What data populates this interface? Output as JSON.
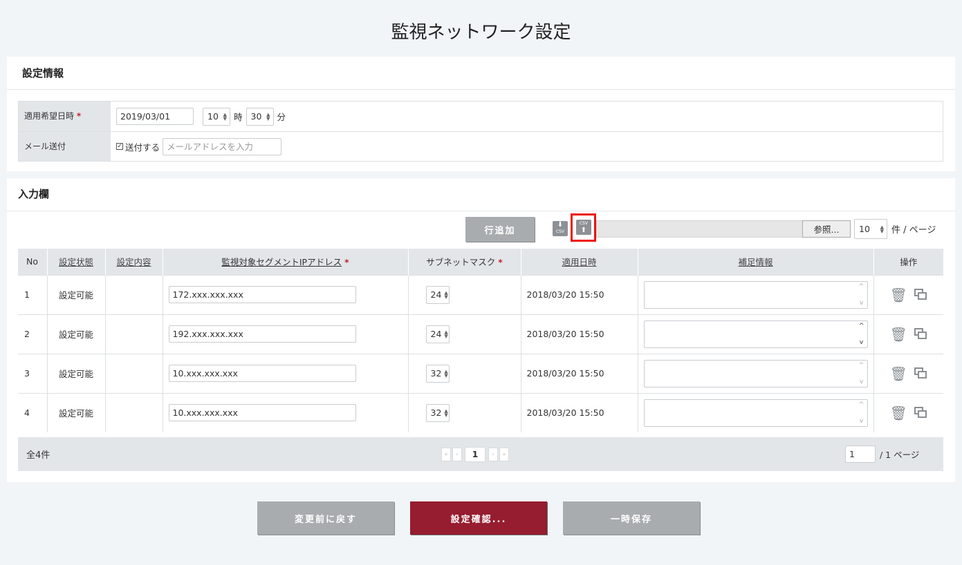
{
  "page": {
    "title": "監視ネットワーク設定"
  },
  "settings": {
    "heading": "設定情報",
    "apply_label": "適用希望日時",
    "required_mark": "*",
    "date_value": "2019/03/01",
    "hour_value": "10",
    "hour_unit": "時",
    "minute_value": "30",
    "minute_unit": "分",
    "mail_label": "メール送付",
    "mail_check_label": "送付する",
    "mail_checked": true,
    "mail_placeholder": "メールアドレスを入力"
  },
  "input_area": {
    "heading": "入力欄",
    "add_row_button": "行追加",
    "csv_export_icon": "csv-download-icon",
    "csv_import_icon": "csv-upload-icon",
    "csv_text": "CSV",
    "browse_button": "参照...",
    "per_page_value": "10",
    "per_page_unit": "件 / ページ"
  },
  "table": {
    "headers": {
      "no": "No",
      "status": "設定状態",
      "content": "設定内容",
      "ip": "監視対象セグメントIPアドレス",
      "mask": "サブネットマスク",
      "date": "適用日時",
      "note": "補足情報",
      "ops": "操作"
    },
    "rows": [
      {
        "no": "1",
        "status": "設定可能",
        "content": "",
        "ip": "172.xxx.xxx.xxx",
        "mask": "24",
        "date": "2018/03/20 15:50",
        "note": ""
      },
      {
        "no": "2",
        "status": "設定可能",
        "content": "",
        "ip": "192.xxx.xxx.xxx",
        "mask": "24",
        "date": "2018/03/20 15:50",
        "note": ""
      },
      {
        "no": "3",
        "status": "設定可能",
        "content": "",
        "ip": "10.xxx.xxx.xxx",
        "mask": "32",
        "date": "2018/03/20 15:50",
        "note": ""
      },
      {
        "no": "4",
        "status": "設定可能",
        "content": "",
        "ip": "10.xxx.xxx.xxx",
        "mask": "32",
        "date": "2018/03/20 15:50",
        "note": ""
      }
    ]
  },
  "pagination": {
    "total": "全4件",
    "current_page": "1",
    "page_input": "1",
    "total_pages": "/ 1 ページ"
  },
  "actions": {
    "revert": "変更前に戻す",
    "confirm": "設定確認...",
    "save": "一時保存"
  },
  "colors": {
    "accent": "#961c2f",
    "required": "#c0252f",
    "highlight": "#e11111"
  }
}
